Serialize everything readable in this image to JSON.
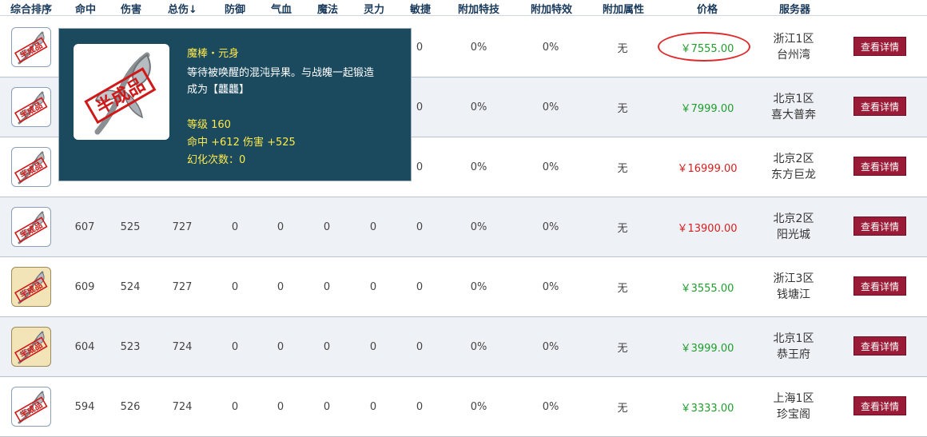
{
  "columns": [
    "综合排序",
    "命中",
    "伤害",
    "总伤↓",
    "防御",
    "气血",
    "魔法",
    "灵力",
    "敏捷",
    "附加特技",
    "附加特效",
    "附加属性",
    "价格",
    "服务器"
  ],
  "rows": [
    {
      "thumb": "gray",
      "hit": "",
      "damage": "",
      "total": "",
      "def": "",
      "hp": "",
      "mp": "",
      "spirit": "",
      "agility": "0",
      "skill": "0%",
      "effect": "0%",
      "attr": "无",
      "price": "￥7555.00",
      "price_color": "#1f9e2d",
      "server_line1": "浙江1区",
      "server_line2": "台州湾",
      "detail": "查看详情"
    },
    {
      "thumb": "gray",
      "hit": "",
      "damage": "",
      "total": "",
      "def": "",
      "hp": "",
      "mp": "",
      "spirit": "",
      "agility": "0",
      "skill": "0%",
      "effect": "0%",
      "attr": "无",
      "price": "￥7999.00",
      "price_color": "#1f9e2d",
      "server_line1": "北京1区",
      "server_line2": "喜大普奔",
      "detail": "查看详情"
    },
    {
      "thumb": "gray",
      "hit": "",
      "damage": "",
      "total": "",
      "def": "",
      "hp": "",
      "mp": "",
      "spirit": "",
      "agility": "0",
      "skill": "0%",
      "effect": "0%",
      "attr": "无",
      "price": "￥16999.00",
      "price_color": "#d61f1f",
      "server_line1": "北京2区",
      "server_line2": "东方巨龙",
      "detail": "查看详情"
    },
    {
      "thumb": "gray",
      "hit": "607",
      "damage": "525",
      "total": "727",
      "def": "0",
      "hp": "0",
      "mp": "0",
      "spirit": "0",
      "agility": "0",
      "skill": "0%",
      "effect": "0%",
      "attr": "无",
      "price": "￥13900.00",
      "price_color": "#d61f1f",
      "server_line1": "北京2区",
      "server_line2": "阳光城",
      "detail": "查看详情"
    },
    {
      "thumb": "gold",
      "hit": "609",
      "damage": "524",
      "total": "727",
      "def": "0",
      "hp": "0",
      "mp": "0",
      "spirit": "0",
      "agility": "0",
      "skill": "0%",
      "effect": "0%",
      "attr": "无",
      "price": "￥3555.00",
      "price_color": "#1f9e2d",
      "server_line1": "浙江3区",
      "server_line2": "钱塘江",
      "detail": "查看详情"
    },
    {
      "thumb": "gold",
      "hit": "604",
      "damage": "523",
      "total": "724",
      "def": "0",
      "hp": "0",
      "mp": "0",
      "spirit": "0",
      "agility": "0",
      "skill": "0%",
      "effect": "0%",
      "attr": "无",
      "price": "￥3999.00",
      "price_color": "#1f9e2d",
      "server_line1": "北京1区",
      "server_line2": "恭王府",
      "detail": "查看详情"
    },
    {
      "thumb": "gray",
      "hit": "594",
      "damage": "526",
      "total": "724",
      "def": "0",
      "hp": "0",
      "mp": "0",
      "spirit": "0",
      "agility": "0",
      "skill": "0%",
      "effect": "0%",
      "attr": "无",
      "price": "￥3333.00",
      "price_color": "#1f9e2d",
      "server_line1": "上海1区",
      "server_line2": "珍宝阁",
      "detail": "查看详情"
    }
  ],
  "tooltip": {
    "name": "魔棒・元身",
    "desc_line1": "等待被唤醒的混沌异果。与战魄一起锻造",
    "desc_line2": "成为【龘龘】",
    "level": "等级 160",
    "stats": "命中 +612 伤害 +525",
    "transform": "幻化次数：0"
  },
  "stamp_text": "半成品",
  "colors": {
    "header_text": "#1a3a5c",
    "price_green": "#1f9e2d",
    "price_red": "#d61f1f",
    "detail_button": "#9a1b37",
    "tooltip_bg": "#1b4a5f",
    "tooltip_highlight": "#ffe94a",
    "highlight_ellipse": "#e02a2a"
  }
}
